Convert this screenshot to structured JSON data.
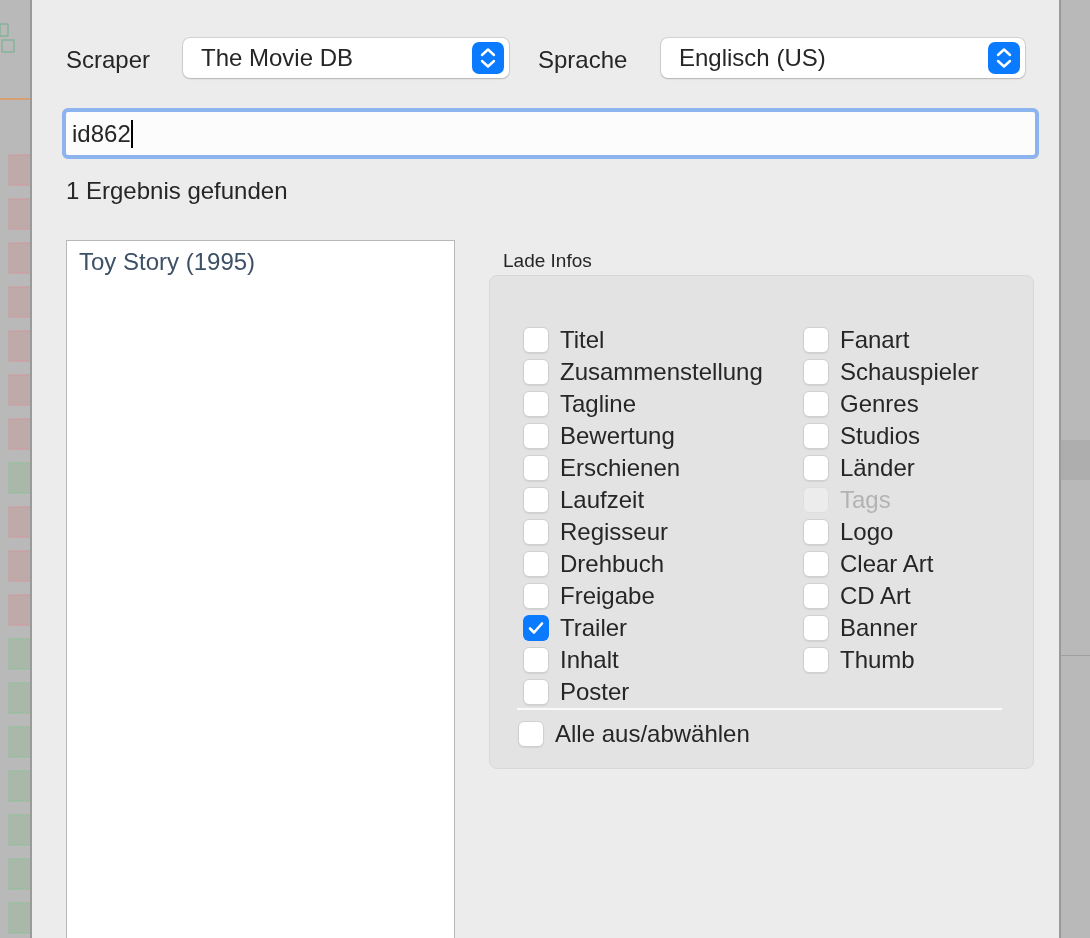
{
  "scraper": {
    "label": "Scraper",
    "value": "The Movie DB"
  },
  "language": {
    "label": "Sprache",
    "value": "Englisch (US)"
  },
  "search": {
    "value": "id862"
  },
  "result_count": "1 Ergebnis gefunden",
  "results": [
    {
      "title": "Toy Story (1995)",
      "selected": false
    }
  ],
  "load_info": {
    "title": "Lade Infos",
    "columns": [
      [
        {
          "label": "Titel",
          "checked": false,
          "disabled": false
        },
        {
          "label": "Zusammenstellung",
          "checked": false,
          "disabled": false
        },
        {
          "label": "Tagline",
          "checked": false,
          "disabled": false
        },
        {
          "label": "Bewertung",
          "checked": false,
          "disabled": false
        },
        {
          "label": "Erschienen",
          "checked": false,
          "disabled": false
        },
        {
          "label": "Laufzeit",
          "checked": false,
          "disabled": false
        },
        {
          "label": "Regisseur",
          "checked": false,
          "disabled": false
        },
        {
          "label": "Drehbuch",
          "checked": false,
          "disabled": false
        },
        {
          "label": "Freigabe",
          "checked": false,
          "disabled": false
        },
        {
          "label": "Trailer",
          "checked": true,
          "disabled": false
        },
        {
          "label": "Inhalt",
          "checked": false,
          "disabled": false
        },
        {
          "label": "Poster",
          "checked": false,
          "disabled": false
        }
      ],
      [
        {
          "label": "Fanart",
          "checked": false,
          "disabled": false
        },
        {
          "label": "Schauspieler",
          "checked": false,
          "disabled": false
        },
        {
          "label": "Genres",
          "checked": false,
          "disabled": false
        },
        {
          "label": "Studios",
          "checked": false,
          "disabled": false
        },
        {
          "label": "Länder",
          "checked": false,
          "disabled": false
        },
        {
          "label": "Tags",
          "checked": false,
          "disabled": true
        },
        {
          "label": "Logo",
          "checked": false,
          "disabled": false
        },
        {
          "label": "Clear Art",
          "checked": false,
          "disabled": false
        },
        {
          "label": "CD Art",
          "checked": false,
          "disabled": false
        },
        {
          "label": "Banner",
          "checked": false,
          "disabled": false
        },
        {
          "label": "Thumb",
          "checked": false,
          "disabled": false
        }
      ]
    ],
    "select_all": {
      "label": "Alle aus/abwählen",
      "checked": false
    }
  }
}
